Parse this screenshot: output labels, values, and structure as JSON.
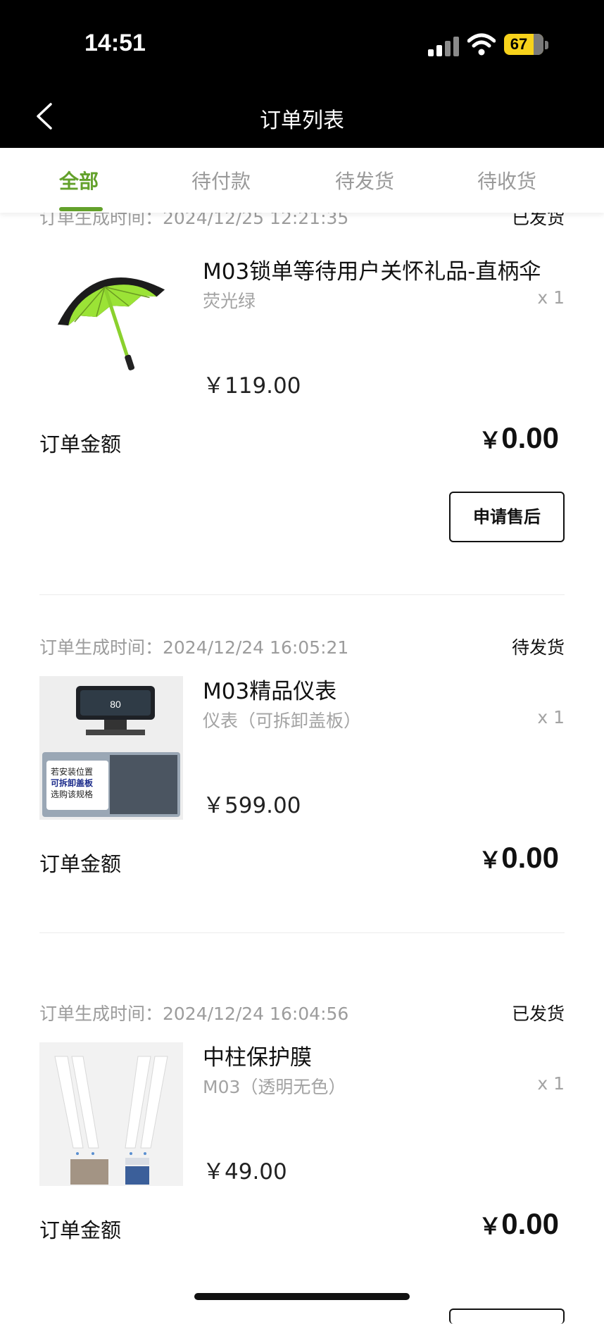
{
  "status_bar": {
    "time": "14:51",
    "battery": "67"
  },
  "nav": {
    "title": "订单列表"
  },
  "tabs": [
    {
      "label": "全部",
      "active": true
    },
    {
      "label": "待付款",
      "active": false
    },
    {
      "label": "待发货",
      "active": false
    },
    {
      "label": "待收货",
      "active": false
    }
  ],
  "orders": [
    {
      "meta": "订单生成时间：2024/12/25 12:21:35",
      "status": "已发货",
      "product": {
        "name": "M03锁单等待用户关怀礼品-直柄伞",
        "spec": "荧光绿",
        "qty": "x 1",
        "price": "￥119.00",
        "image": "umbrella"
      },
      "amount_label": "订单金额",
      "currency": "￥",
      "amount": "0.00",
      "action": "申请售后"
    },
    {
      "meta": "订单生成时间：2024/12/24 16:05:21",
      "status": "待发货",
      "product": {
        "name": "M03精品仪表",
        "spec": "仪表（可拆卸盖板）",
        "qty": "x 1",
        "price": "￥599.00",
        "image": "dashboard",
        "image_text": {
          "speed": "80",
          "line1": "若安装位置",
          "line2": "可拆卸盖板",
          "line3": "选购该规格"
        }
      },
      "amount_label": "订单金额",
      "currency": "￥",
      "amount": "0.00"
    },
    {
      "meta": "订单生成时间：2024/12/24 16:04:56",
      "status": "已发货",
      "product": {
        "name": "中柱保护膜",
        "spec": "M03（透明无色）",
        "qty": "x 1",
        "price": "￥49.00",
        "image": "pillar-film"
      },
      "amount_label": "订单金额",
      "currency": "￥",
      "amount": "0.00"
    }
  ],
  "colors": {
    "accent": "#63a12b",
    "header_bg": "#000000"
  }
}
